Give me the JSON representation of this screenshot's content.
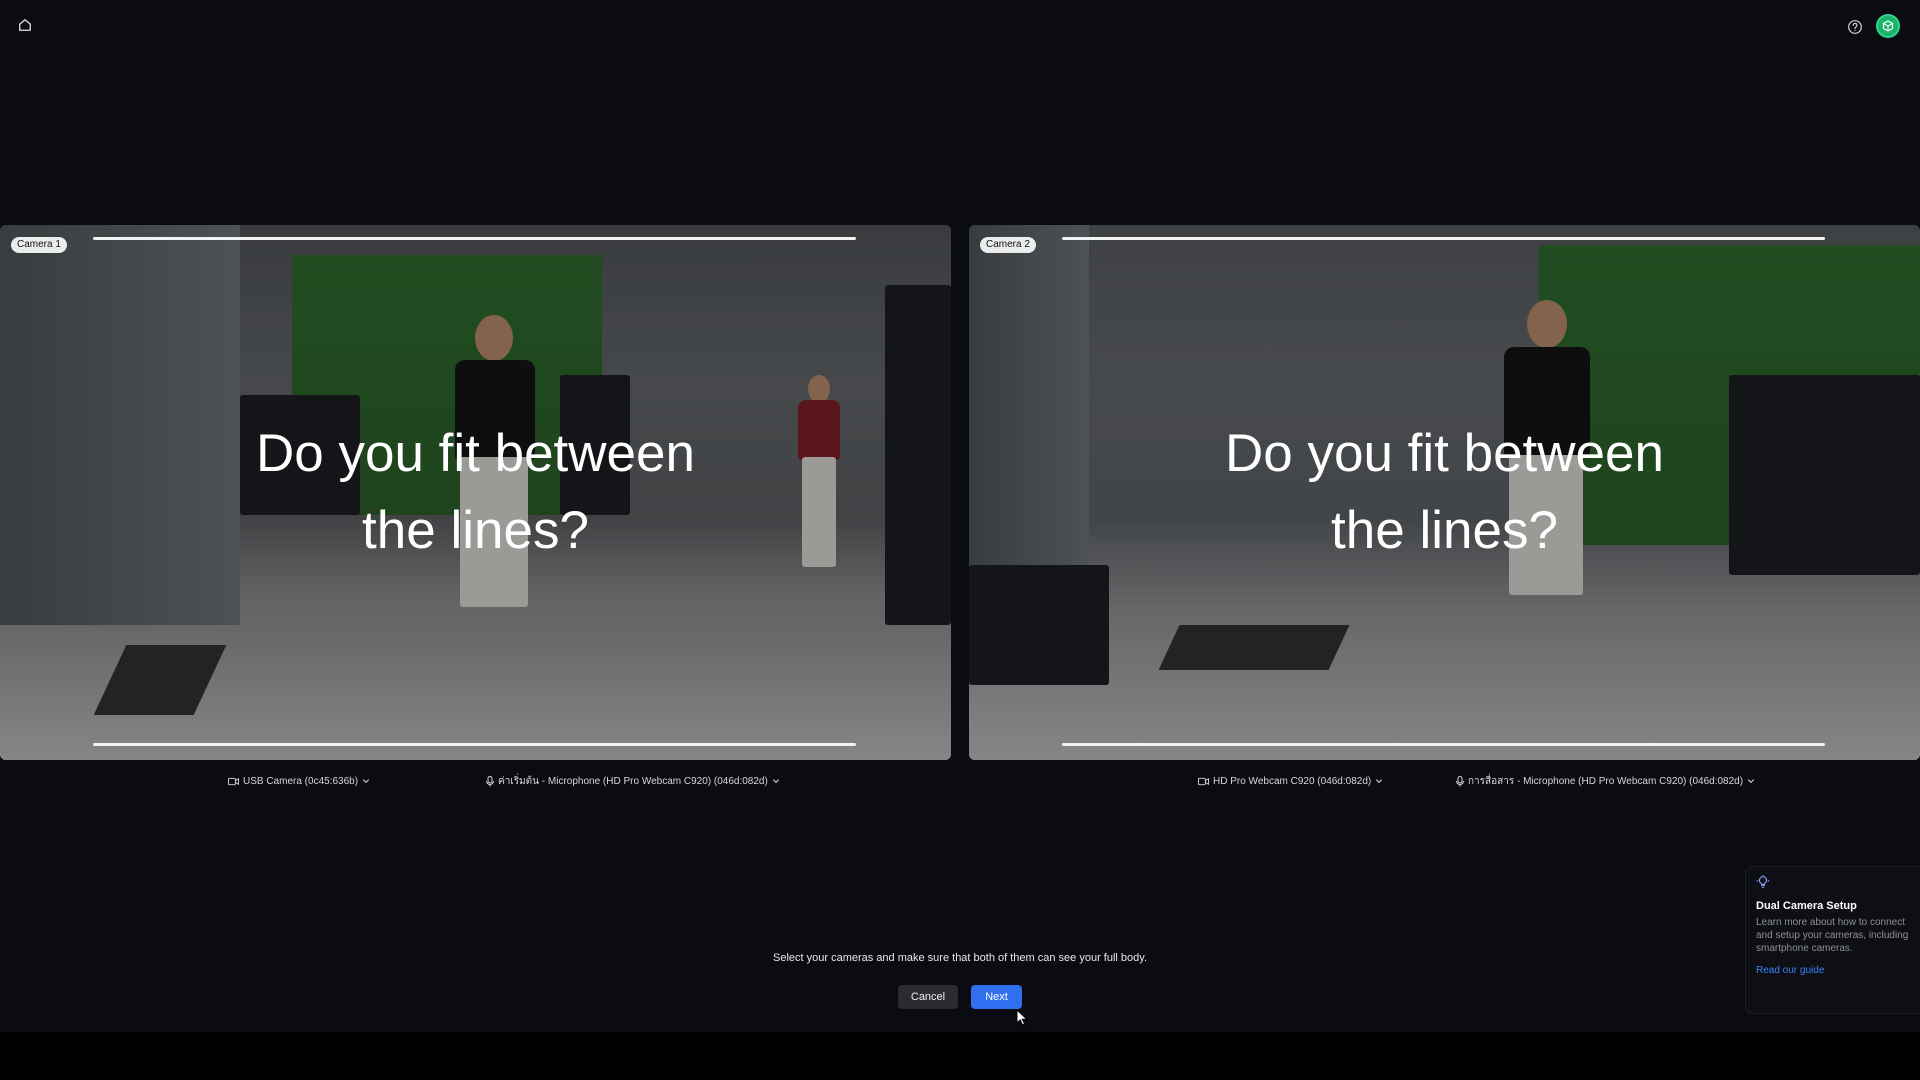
{
  "topbar": {
    "home_icon": "home-icon",
    "help_icon": "help-icon",
    "avatar_icon": "avatar-icon"
  },
  "cameras": [
    {
      "badge": "Camera 1",
      "prompt_line1": "Do you fit between",
      "prompt_line2": "the lines?",
      "video_device": "USB Camera (0c45:636b)",
      "audio_device": "ค่าเริ่มต้น - Microphone (HD Pro Webcam C920) (046d:082d)"
    },
    {
      "badge": "Camera 2",
      "prompt_line1": "Do you fit between",
      "prompt_line2": "the lines?",
      "video_device": "HD Pro Webcam C920 (046d:082d)",
      "audio_device": "การสื่อสาร - Microphone (HD Pro Webcam C920) (046d:082d)"
    }
  ],
  "instruction": "Select your cameras and make sure that both of them can see your full body.",
  "actions": {
    "cancel_label": "Cancel",
    "next_label": "Next"
  },
  "guide_card": {
    "icon": "lightbulb-icon",
    "title": "Dual Camera Setup",
    "description": "Learn more about how to connect and setup your cameras, including smartphone cameras.",
    "link_label": "Read our guide"
  },
  "colors": {
    "background": "#0b0c12",
    "accent": "#2f6ff0",
    "link": "#3c82f6",
    "avatar": "#1bb36b"
  }
}
